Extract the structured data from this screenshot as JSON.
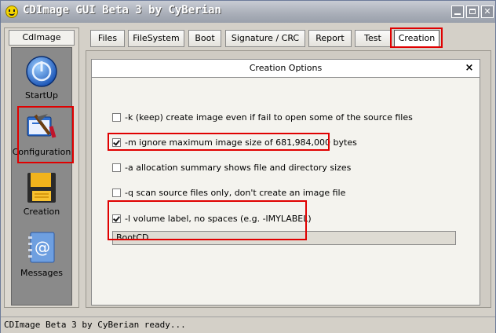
{
  "window": {
    "title": "CDImage GUI Beta 3 by CyBerian"
  },
  "sidebar": {
    "header": "CdImage",
    "items": [
      {
        "label": "StartUp",
        "icon": "power-icon"
      },
      {
        "label": "Configuration",
        "icon": "tools-icon",
        "highlighted": true
      },
      {
        "label": "Creation",
        "icon": "floppy-disk-icon"
      },
      {
        "label": "Messages",
        "icon": "address-book-icon"
      }
    ]
  },
  "tabs": [
    {
      "label": "Files"
    },
    {
      "label": "FileSystem"
    },
    {
      "label": "Boot"
    },
    {
      "label": "Signature / CRC"
    },
    {
      "label": "Report"
    },
    {
      "label": "Test"
    },
    {
      "label": "Creation",
      "active": true
    }
  ],
  "dialog": {
    "title": "Creation Options",
    "close": "×",
    "options": [
      {
        "label": "-k  (keep) create image even if fail to open some of the source files",
        "checked": false
      },
      {
        "label": "-m  ignore maximum image size of 681,984,000 bytes",
        "checked": true
      },
      {
        "label": "-a  allocation summary shows file and directory sizes",
        "checked": false
      },
      {
        "label": "-q  scan source files only, don't create an image file",
        "checked": false
      },
      {
        "label": "-l  volume label, no spaces (e.g. -lMYLABEL)",
        "checked": true
      }
    ],
    "volume_label_value": "BootCD"
  },
  "status": {
    "text": "CDImage Beta 3 by CyBerian ready..."
  },
  "colors": {
    "highlight": "#e00000",
    "titlebar": "#a9aeb8"
  }
}
